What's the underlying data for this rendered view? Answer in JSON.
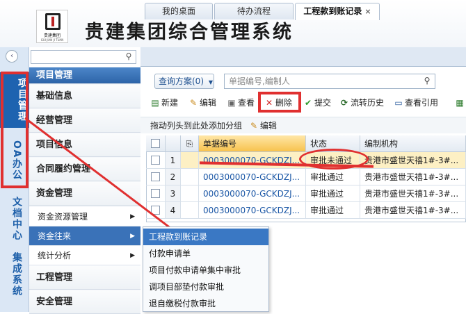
{
  "header": {
    "app_title": "贵建集团综合管理系统",
    "logo_text": "贵建集团",
    "logo_sub": "GUI JIAN JI TUAN"
  },
  "left_nav": {
    "items": [
      "项目管理",
      "OA办公",
      "文档中心",
      "集成系统"
    ]
  },
  "sidebar": {
    "search_placeholder": "",
    "header": "项目管理",
    "items": [
      "基础信息",
      "经营管理",
      "项目信息",
      "合同履约管理",
      "资金管理"
    ],
    "subitems": [
      "资金资源管理",
      "资金往来",
      "统计分析"
    ],
    "items_after": [
      "工程管理",
      "安全管理"
    ]
  },
  "tabs": [
    {
      "label": "我的桌面"
    },
    {
      "label": "待办流程"
    },
    {
      "label": "工程款到账记录",
      "close": "×"
    }
  ],
  "toolbar": {
    "scheme_label": "查询方案(0)",
    "query_placeholder": "单据编号,编制人",
    "buttons": [
      "新建",
      "编辑",
      "查看",
      "删除",
      "提交",
      "流转历史",
      "查看引用"
    ]
  },
  "group_bar": {
    "hint": "拖动列头到此处添加分组",
    "edit": "编辑"
  },
  "grid": {
    "columns": [
      "单据编号",
      "状态",
      "编制机构"
    ],
    "rows": [
      {
        "num": "1",
        "doc_no": "0003000070-GCKDZJ...",
        "status": "审批未通过",
        "org": "贵港市盛世天禧1#-3#..."
      },
      {
        "num": "2",
        "doc_no": "0003000070-GCKDZJ...",
        "status": "审批通过",
        "org": "贵港市盛世天禧1#-3#..."
      },
      {
        "num": "3",
        "doc_no": "0003000070-GCKDZJ...",
        "status": "审批通过",
        "org": "贵港市盛世天禧1#-3#..."
      },
      {
        "num": "4",
        "doc_no": "0003000070-GCKDZJ...",
        "status": "审批通过",
        "org": "贵港市盛世天禧1#-3#..."
      }
    ]
  },
  "submenu": {
    "items": [
      "工程款到账记录",
      "付款申请单",
      "项目付款申请单集中审批",
      "调项目部垫付款审批",
      "退自缴税付款审批"
    ]
  },
  "colors": {
    "accent": "#2d64a8",
    "annotation": "#e03030"
  }
}
